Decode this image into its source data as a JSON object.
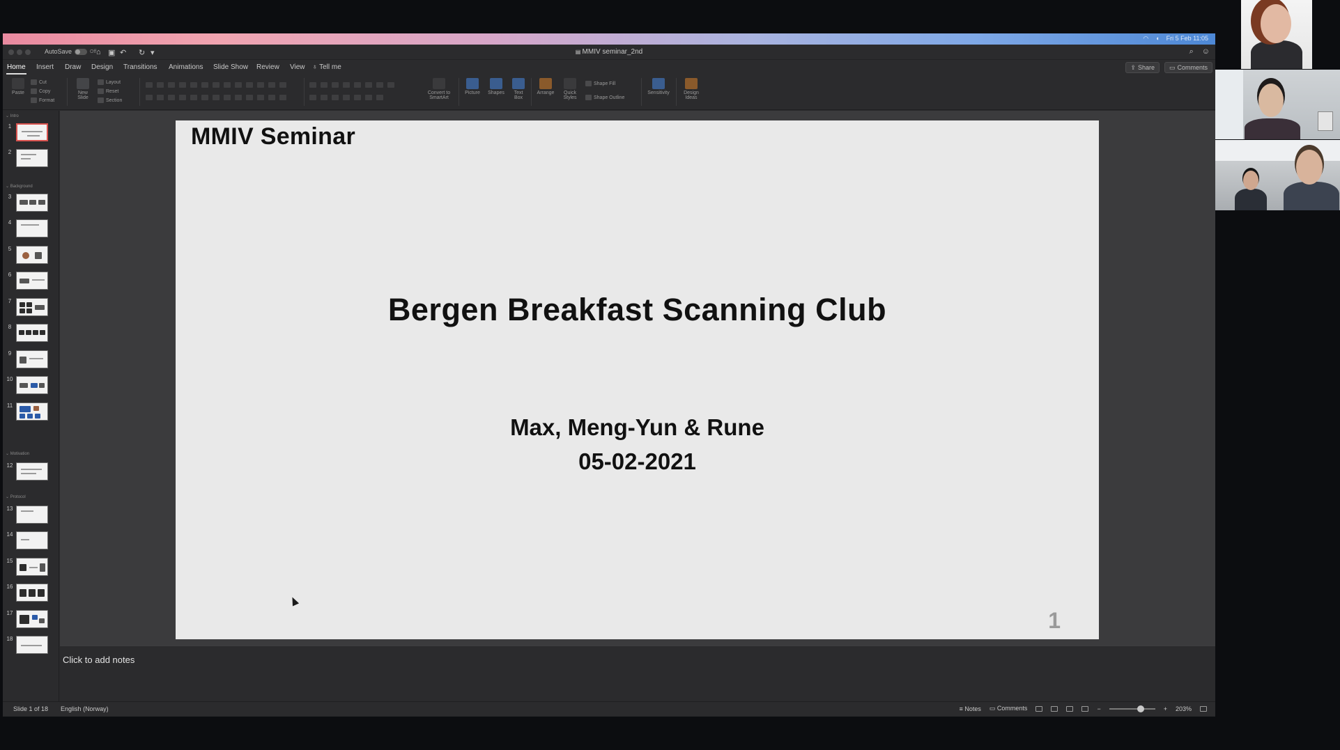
{
  "menubar": {
    "clock": "Fri 5 Feb 11:05"
  },
  "app": {
    "autosave_label": "AutoSave",
    "autosave_state": "Off",
    "document_title": "MMIV seminar_2nd"
  },
  "tabs": [
    {
      "label": "Home",
      "active": true
    },
    {
      "label": "Insert"
    },
    {
      "label": "Draw"
    },
    {
      "label": "Design"
    },
    {
      "label": "Transitions"
    },
    {
      "label": "Animations"
    },
    {
      "label": "Slide Show"
    },
    {
      "label": "Review"
    },
    {
      "label": "View"
    },
    {
      "label": "Tell me"
    }
  ],
  "share_label": "Share",
  "comments_button_label": "Comments",
  "ribbon": {
    "paste": "Paste",
    "cut": "Cut",
    "copy": "Copy",
    "format": "Format",
    "new_slide": "New Slide",
    "layout": "Layout",
    "reset": "Reset",
    "section": "Section",
    "convert_smartart": "Convert to SmartArt",
    "picture": "Picture",
    "shapes": "Shapes",
    "text_box": "Text Box",
    "arrange": "Arrange",
    "quick_styles": "Quick Styles",
    "shape_fill": "Shape Fill",
    "shape_outline": "Shape Outline",
    "sensitivity": "Sensitivity",
    "design_ideas": "Design Ideas"
  },
  "sections": [
    {
      "label": "Intro",
      "after_slide": 0
    },
    {
      "label": "Background",
      "after_slide": 2
    },
    {
      "label": "Motivation",
      "after_slide": 11
    },
    {
      "label": "Protocol",
      "after_slide": 12
    }
  ],
  "slides": [
    {
      "num": "1"
    },
    {
      "num": "2"
    },
    {
      "num": "3"
    },
    {
      "num": "4"
    },
    {
      "num": "5"
    },
    {
      "num": "6"
    },
    {
      "num": "7"
    },
    {
      "num": "8"
    },
    {
      "num": "9"
    },
    {
      "num": "10"
    },
    {
      "num": "11"
    },
    {
      "num": "12"
    },
    {
      "num": "13"
    },
    {
      "num": "14"
    },
    {
      "num": "15"
    },
    {
      "num": "16"
    },
    {
      "num": "17"
    },
    {
      "num": "18"
    }
  ],
  "slide": {
    "header": "MMIV Seminar",
    "title": "Bergen Breakfast Scanning Club",
    "authors": "Max, Meng-Yun & Rune",
    "date": "05-02-2021",
    "number": "1"
  },
  "notes_placeholder": "Click to add notes",
  "status": {
    "slide_position": "Slide 1 of 18",
    "language": "English (Norway)",
    "notes_label": "Notes",
    "comments_label": "Comments",
    "zoom": "203%"
  },
  "colors": {
    "accent_selected_thumb": "#d9534f",
    "slide_background": "#e9e9e9",
    "window_dark": "#2b2b2d"
  }
}
